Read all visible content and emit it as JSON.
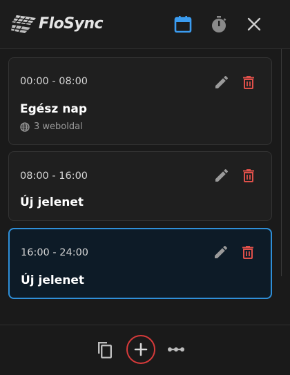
{
  "header": {
    "title": "FloSync",
    "logo_icon": "flosync-logo-icon",
    "buttons": [
      {
        "name": "calendar-icon",
        "color": "#3b9cf0"
      },
      {
        "name": "timer-icon",
        "color": "#8a8a8a"
      },
      {
        "name": "close-icon",
        "color": "#cfcfcf"
      }
    ]
  },
  "scenes": [
    {
      "time": "00:00 - 08:00",
      "title": "Egész nap",
      "meta": "3 weboldal",
      "active": false
    },
    {
      "time": "08:00 - 16:00",
      "title": "Új jelenet",
      "meta": "",
      "active": false
    },
    {
      "time": "16:00 - 24:00",
      "title": "Új jelenet",
      "meta": "",
      "active": true
    }
  ],
  "footer": {
    "buttons": [
      {
        "name": "copy-icon"
      },
      {
        "name": "add-icon"
      },
      {
        "name": "more-icon"
      }
    ]
  },
  "colors": {
    "accent": "#2f8fd8",
    "delete": "#e0504a",
    "edit": "#9a9a9a",
    "highlight_ring": "#d63a3a"
  }
}
